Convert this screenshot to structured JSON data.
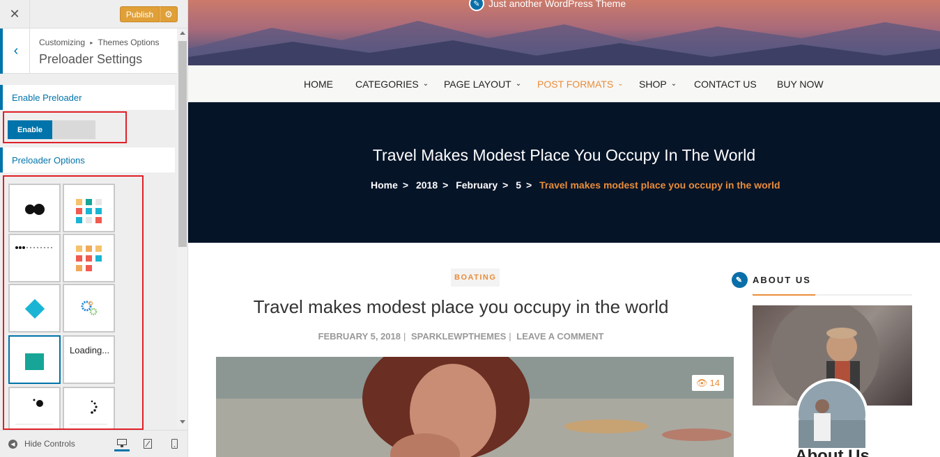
{
  "customizer": {
    "publish_label": "Publish",
    "breadcrumb": [
      "Customizing",
      "Themes Options"
    ],
    "section_title": "Preloader Settings",
    "enable_label": "Enable Preloader",
    "toggle_on_label": "Enable",
    "options_label": "Preloader Options",
    "loader_text": "Loading...",
    "hide_controls_label": "Hide Controls"
  },
  "site": {
    "tagline": "Just another WordPress Theme",
    "nav": [
      {
        "label": "HOME"
      },
      {
        "label": "CATEGORIES"
      },
      {
        "label": "PAGE LAYOUT"
      },
      {
        "label": "POST FORMATS"
      },
      {
        "label": "SHOP"
      },
      {
        "label": "CONTACT US"
      },
      {
        "label": "BUY NOW"
      }
    ],
    "banner": {
      "title": "Travel Makes Modest Place You Occupy In The World",
      "breadcrumb": [
        "Home",
        "2018",
        "February",
        "5"
      ],
      "current": "Travel makes modest place you occupy in the world"
    },
    "post": {
      "category": "BOATING",
      "title": "Travel makes modest place you occupy in the world",
      "date": "FEBRUARY 5, 2018",
      "author": "SPARKLEWPTHEMES",
      "comment": "LEAVE A COMMENT",
      "views": "14"
    },
    "about": {
      "heading": "ABOUT US",
      "name": "About Us"
    }
  },
  "colors": {
    "wp_blue": "#0073aa",
    "accent_orange": "#e98d3a",
    "banner_dark": "#061428",
    "publish": "#e0a037",
    "highlight_red": "#e01f26"
  }
}
